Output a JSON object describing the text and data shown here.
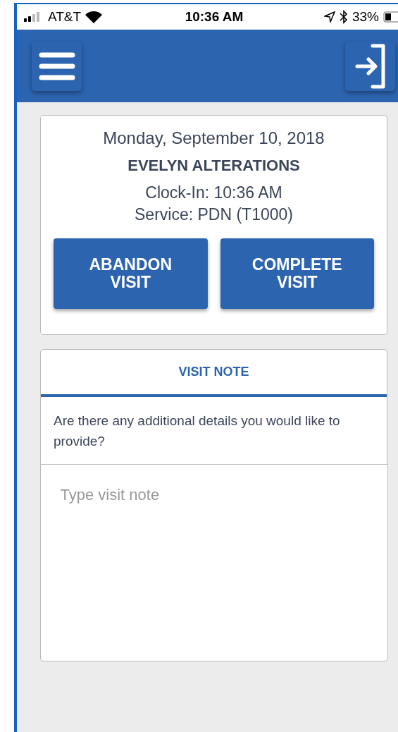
{
  "status_bar": {
    "carrier": "AT&T",
    "time": "10:36 AM",
    "battery": "33%"
  },
  "visit": {
    "date": "Monday, September 10, 2018",
    "client": "EVELYN ALTERATIONS",
    "clock_in": "Clock-In: 10:36 AM",
    "service": "Service: PDN (T1000)"
  },
  "buttons": [
    "ABANDON VISIT",
    "COMPLETE VISIT"
  ],
  "note": {
    "tabs": [
      {
        "label": "VISIT NOTE",
        "selected": true
      }
    ],
    "prompt": "Are there any additional details you would like to provide?",
    "placeholder": "Type visit note"
  }
}
